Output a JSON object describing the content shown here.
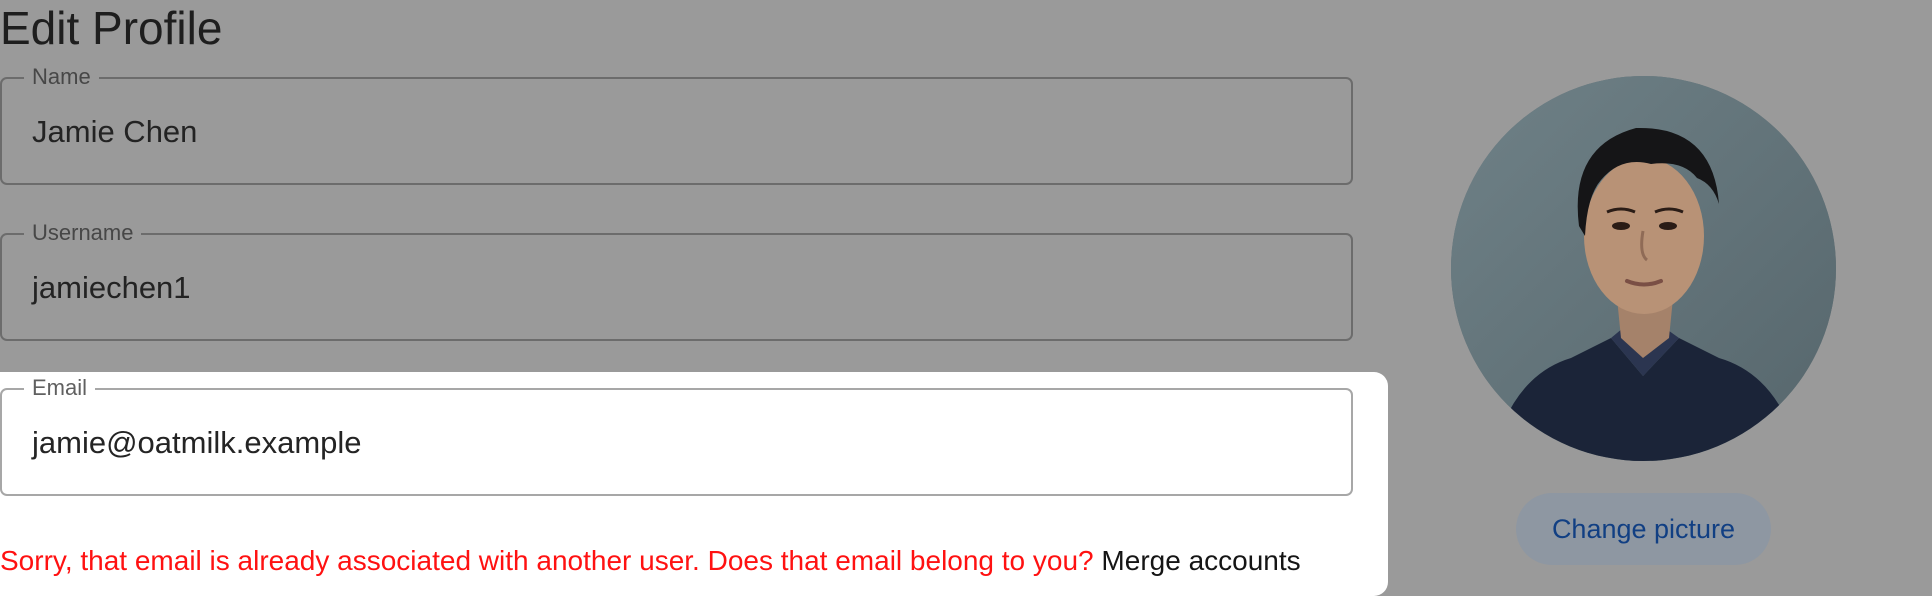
{
  "page": {
    "title": "Edit Profile"
  },
  "form": {
    "name": {
      "label": "Name",
      "value": "Jamie Chen"
    },
    "username": {
      "label": "Username",
      "value": "jamiechen1"
    },
    "email": {
      "label": "Email",
      "value": "jamie@oatmilk.example"
    },
    "email_error": {
      "message": "Sorry, that email is already associated with another user. Does that email belong to you?",
      "action_label": "Merge accounts"
    }
  },
  "profile_picture": {
    "icon": "avatar-photo",
    "change_label": "Change picture"
  },
  "colors": {
    "overlay": "#9a9a9a",
    "spotlight": "#ffffff",
    "error": "#ff1111",
    "button_text": "#113f83"
  }
}
